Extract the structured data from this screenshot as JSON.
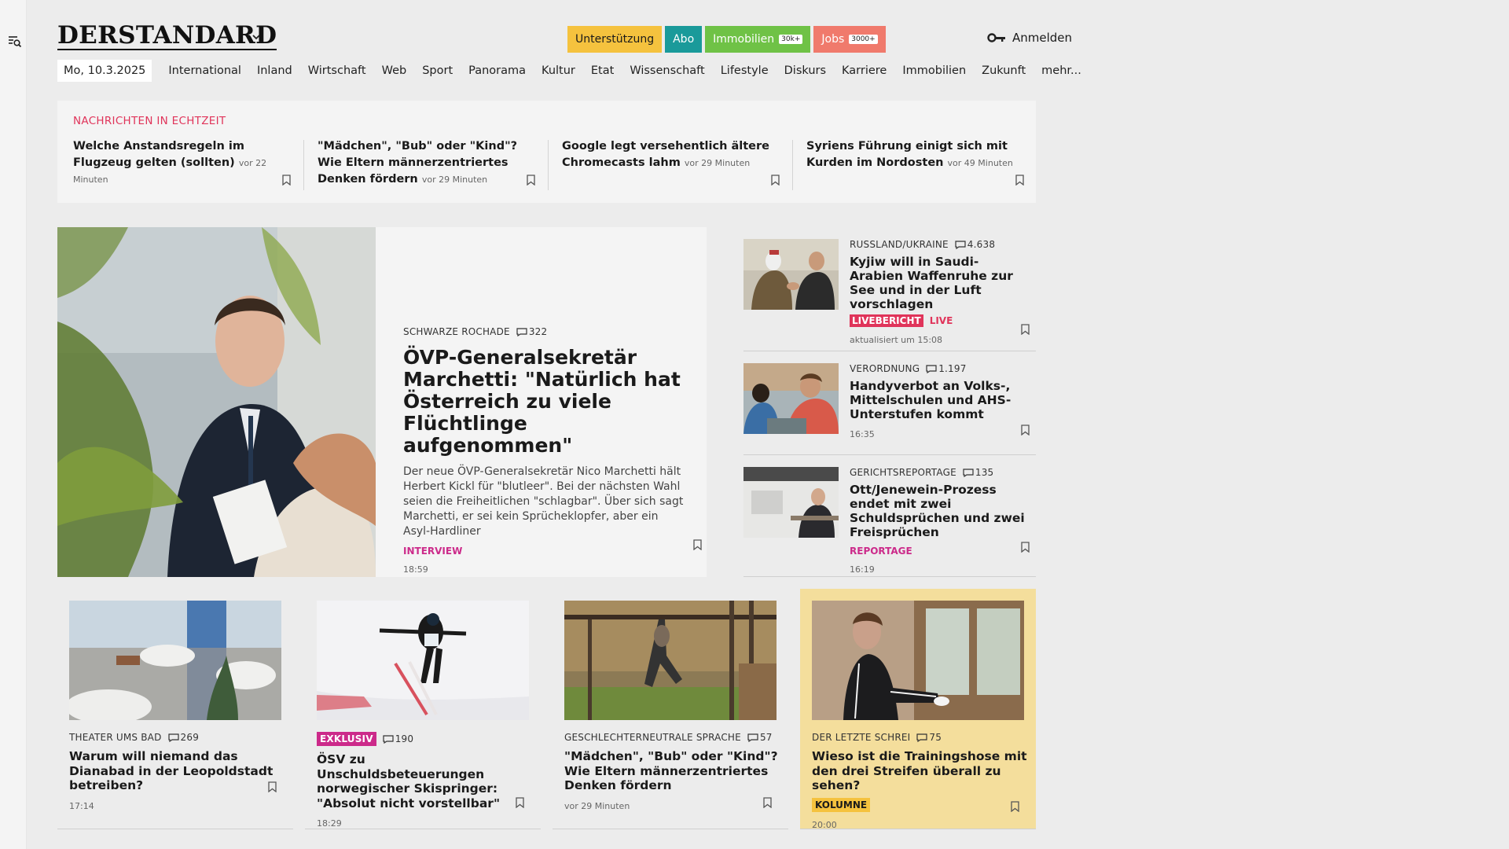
{
  "site": {
    "logo": "DERSTANDARD",
    "pills": [
      {
        "label": "Unterstützung",
        "badge": ""
      },
      {
        "label": "Abo",
        "badge": ""
      },
      {
        "label": "Immobilien",
        "badge": "30k+"
      },
      {
        "label": "Jobs",
        "badge": "3000+"
      }
    ],
    "login_label": "Anmelden"
  },
  "nav": {
    "date": "Mo, 10.3.2025",
    "items": [
      "International",
      "Inland",
      "Wirtschaft",
      "Web",
      "Sport",
      "Panorama",
      "Kultur",
      "Etat",
      "Wissenschaft",
      "Lifestyle",
      "Diskurs",
      "Karriere",
      "Immobilien",
      "Zukunft",
      "mehr..."
    ]
  },
  "ticker": {
    "heading": "NACHRICHTEN IN ECHTZEIT",
    "items": [
      {
        "title": "Welche Anstandsregeln im Flugzeug gelten (sollten)",
        "time": "vor 22 Minuten"
      },
      {
        "title": "\"Mädchen\", \"Bub\" oder \"Kind\"? Wie Eltern männerzentriertes Denken fördern",
        "time": "vor 29 Minuten"
      },
      {
        "title": "Google legt versehentlich ältere Chromecasts lahm",
        "time": "vor 29 Minuten"
      },
      {
        "title": "Syriens Führung einigt sich mit Kurden im Nordosten",
        "time": "vor 49 Minuten"
      }
    ]
  },
  "hero": {
    "kicker": "SCHWARZE ROCHADE",
    "comments": "322",
    "title": "ÖVP-Generalsekretär Marchetti: \"Natürlich hat Österreich zu viele Flüchtlinge aufgenommen\"",
    "description": "Der neue ÖVP-Generalsekretär Nico Marchetti hält Herbert Kickl für \"blutleer\". Bei der nächsten Wahl seien die Freiheitlichen \"schlagbar\". Über sich sagt Marchetti, er sei kein Sprücheklopfer, aber ein Asyl-Hardliner",
    "tag": "INTERVIEW",
    "time": "18:59"
  },
  "side": [
    {
      "kicker": "RUSSLAND/UKRAINE",
      "comments": "4.638",
      "title": "Kyjiw will in Saudi-Arabien Waffenruhe zur See und in der Luft vorschlagen",
      "live_badge": "LIVEBERICHT",
      "live_text": "LIVE",
      "time": "aktualisiert um 15:08"
    },
    {
      "kicker": "VERORDNUNG",
      "comments": "1.197",
      "title": "Handyverbot an Volks-, Mittelschulen und AHS-Unterstufen kommt",
      "time": "16:35"
    },
    {
      "kicker": "GERICHTSREPORTAGE",
      "comments": "135",
      "title": "Ott/Jenewein-Prozess endet mit zwei Schuldsprüchen und zwei Freisprüchen",
      "tag": "REPORTAGE",
      "time": "16:19"
    }
  ],
  "cards": [
    {
      "kicker": "THEATER UMS BAD",
      "comments": "269",
      "title": "Warum will niemand das Dianabad in der Leopoldstadt betreiben?",
      "time": "17:14"
    },
    {
      "badge": "EXKLUSIV",
      "comments": "190",
      "title": "ÖSV zu Unschuldsbeteuerungen norwegischer Skispringer: \"Absolut nicht vorstellbar\"",
      "time": "18:29"
    },
    {
      "kicker": "GESCHLECHTERNEUTRALE SPRACHE",
      "comments": "57",
      "title": "\"Mädchen\", \"Bub\" oder \"Kind\"? Wie Eltern männerzentriertes Denken fördern",
      "time": "vor 29 Minuten"
    },
    {
      "kicker": "DER LETZTE SCHREI",
      "comments": "75",
      "title": "Wieso ist die Trainingshose mit den drei Streifen überall zu sehen?",
      "tag": "KOLUMNE",
      "time": "20:00"
    }
  ],
  "colors": {
    "accent_red": "#e0345a",
    "pink": "#cc2a8a",
    "yellow": "#f5c23e",
    "teal": "#1a9a9a",
    "green": "#6fc246",
    "salmon": "#f07a6c"
  },
  "icons": [
    "search-menu-icon",
    "chevron-down-icon",
    "key-icon",
    "comment-icon",
    "bookmark-icon"
  ]
}
